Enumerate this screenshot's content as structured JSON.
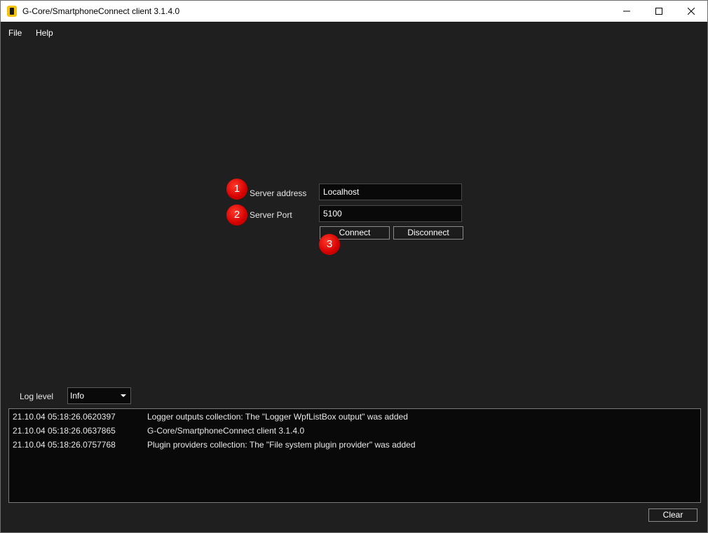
{
  "window": {
    "title": "G-Core/SmartphoneConnect client 3.1.4.0",
    "icon": "app-icon"
  },
  "menu": {
    "items": [
      {
        "label": "File"
      },
      {
        "label": "Help"
      }
    ]
  },
  "connection": {
    "address_label": "Server address",
    "address_value": "Localhost",
    "port_label": "Server Port",
    "port_value": "5100",
    "connect_label": "Connect",
    "disconnect_label": "Disconnect"
  },
  "annotations": [
    "1",
    "2",
    "3"
  ],
  "log": {
    "level_label": "Log level",
    "level_value": "Info",
    "entries": [
      {
        "time": "21.10.04 05:18:26.0620397",
        "message": "Logger outputs collection: The \"Logger WpfListBox output\" was added"
      },
      {
        "time": "21.10.04 05:18:26.0637865",
        "message": "G-Core/SmartphoneConnect client 3.1.4.0"
      },
      {
        "time": "21.10.04 05:18:26.0757768",
        "message": "Plugin providers collection: The \"File system plugin provider\" was added"
      }
    ],
    "clear_label": "Clear"
  },
  "colors": {
    "background": "#1f1f1f",
    "field_background": "#090909",
    "badge_red": "#d40000"
  }
}
